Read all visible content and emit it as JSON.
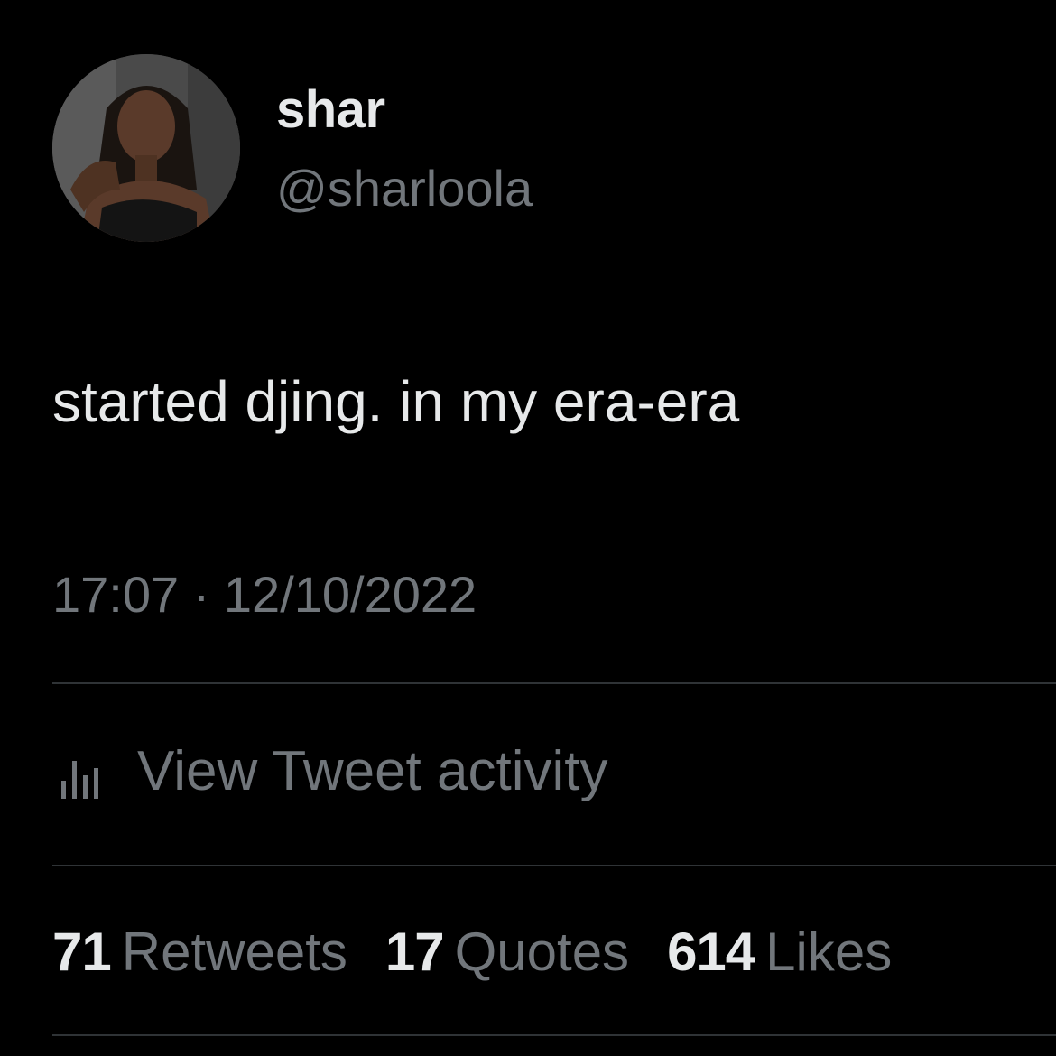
{
  "colors": {
    "background": "#000000",
    "primary_text": "#e7e9ea",
    "secondary_text": "#71767b",
    "divider": "#2f3336"
  },
  "author": {
    "display_name": "shar",
    "handle": "@sharloola",
    "avatar_icon": "profile-photo"
  },
  "tweet": {
    "text": "started djing. in my era-era",
    "timestamp": "17:07 · 12/10/2022"
  },
  "activity": {
    "icon": "bar-chart-icon",
    "label": "View Tweet activity"
  },
  "stats": {
    "retweets": {
      "count": "71",
      "label": "Retweets"
    },
    "quotes": {
      "count": "17",
      "label": "Quotes"
    },
    "likes": {
      "count": "614",
      "label": "Likes"
    }
  }
}
